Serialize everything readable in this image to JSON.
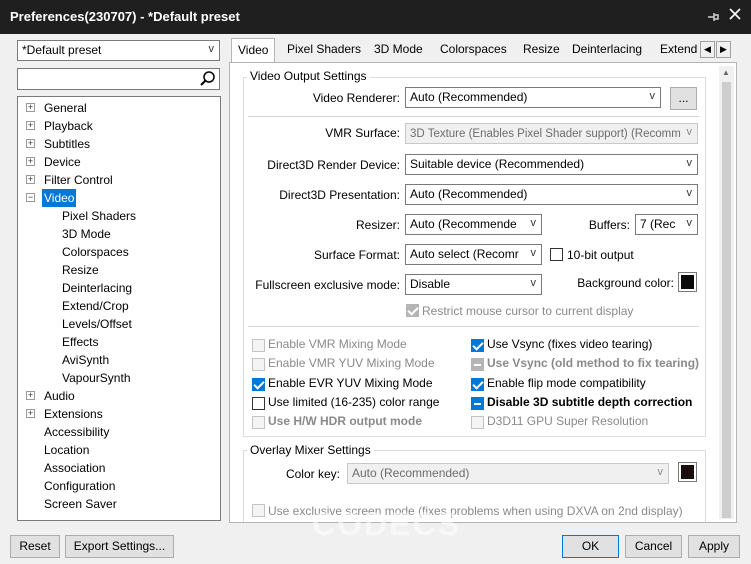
{
  "window": {
    "title": "Preferences(230707) - *Default preset",
    "pin_icon": "pin-icon",
    "close_icon": "close-icon"
  },
  "sidebar": {
    "preset_value": "*Default preset",
    "search_placeholder": "",
    "tree": [
      {
        "label": "General",
        "expandable": true,
        "level": 0
      },
      {
        "label": "Playback",
        "expandable": true,
        "level": 0
      },
      {
        "label": "Subtitles",
        "expandable": true,
        "level": 0
      },
      {
        "label": "Device",
        "expandable": true,
        "level": 0
      },
      {
        "label": "Filter Control",
        "expandable": true,
        "level": 0
      },
      {
        "label": "Video",
        "expandable": true,
        "expanded": true,
        "selected": true,
        "level": 0
      },
      {
        "label": "Pixel Shaders",
        "level": 1
      },
      {
        "label": "3D Mode",
        "level": 1
      },
      {
        "label": "Colorspaces",
        "level": 1
      },
      {
        "label": "Resize",
        "level": 1
      },
      {
        "label": "Deinterlacing",
        "level": 1
      },
      {
        "label": "Extend/Crop",
        "level": 1
      },
      {
        "label": "Levels/Offset",
        "level": 1
      },
      {
        "label": "Effects",
        "level": 1
      },
      {
        "label": "AviSynth",
        "level": 1
      },
      {
        "label": "VapourSynth",
        "level": 1
      },
      {
        "label": "Audio",
        "expandable": true,
        "level": 0
      },
      {
        "label": "Extensions",
        "expandable": true,
        "level": 0
      },
      {
        "label": "Accessibility",
        "level": 0
      },
      {
        "label": "Location",
        "level": 0
      },
      {
        "label": "Association",
        "level": 0
      },
      {
        "label": "Configuration",
        "level": 0
      },
      {
        "label": "Screen Saver",
        "level": 0
      }
    ]
  },
  "tabs": [
    "Video",
    "Pixel Shaders",
    "3D Mode",
    "Colorspaces",
    "Resize",
    "Deinterlacing",
    "Extend"
  ],
  "video_output": {
    "group_title": "Video Output Settings",
    "renderer_label": "Video Renderer:",
    "renderer_value": "Auto (Recommended)",
    "renderer_more": "...",
    "vmr_surface_label": "VMR Surface:",
    "vmr_surface_value": "3D Texture (Enables Pixel Shader support) (Recomm",
    "d3d_device_label": "Direct3D Render Device:",
    "d3d_device_value": "Suitable device (Recommended)",
    "d3d_presentation_label": "Direct3D Presentation:",
    "d3d_presentation_value": "Auto (Recommended)",
    "resizer_label": "Resizer:",
    "resizer_value": "Auto (Recommende",
    "buffers_label": "Buffers:",
    "buffers_value": "7 (Rec",
    "surface_format_label": "Surface Format:",
    "surface_format_value": "Auto select (Recomr",
    "tenbit_label": "10-bit output",
    "fullscreen_label": "Fullscreen exclusive mode:",
    "fullscreen_value": "Disable",
    "bg_color_label": "Background color:",
    "bg_color": "#0a0a0a",
    "restrict_mouse_label": "Restrict mouse cursor to current display"
  },
  "checkboxes_left": [
    {
      "label": "Enable VMR Mixing Mode",
      "checked": false,
      "disabled": true,
      "bold": false
    },
    {
      "label": "Enable VMR YUV Mixing Mode",
      "checked": false,
      "disabled": true,
      "bold": false
    },
    {
      "label": "Enable EVR YUV Mixing Mode",
      "checked": true,
      "disabled": false,
      "bold": false
    },
    {
      "label": "Use limited (16-235) color range",
      "checked": false,
      "disabled": false,
      "bold": false
    },
    {
      "label": "Use H/W HDR output mode",
      "checked": false,
      "disabled": true,
      "bold": true
    }
  ],
  "checkboxes_right": [
    {
      "label": "Use Vsync (fixes video tearing)",
      "state": "checked",
      "disabled": false,
      "bold": false
    },
    {
      "label": "Use Vsync (old method to fix tearing)",
      "state": "indeterminate",
      "disabled": true,
      "bold": true
    },
    {
      "label": "Enable flip mode compatibility",
      "state": "checked",
      "disabled": false,
      "bold": false
    },
    {
      "label": "Disable 3D subtitle depth correction",
      "state": "indeterminate",
      "disabled": false,
      "bold": true
    },
    {
      "label": "D3D11 GPU Super Resolution",
      "state": "unchecked",
      "disabled": true,
      "bold": false
    }
  ],
  "overlay": {
    "group_title": "Overlay Mixer Settings",
    "color_key_label": "Color key:",
    "color_key_value": "Auto (Recommended)",
    "color_key_color": "#1a0d0d",
    "exclusive_label": "Use exclusive screen mode (fixes problems when using DXVA on 2nd display)"
  },
  "footer": {
    "reset": "Reset",
    "export": "Export Settings...",
    "ok": "OK",
    "cancel": "Cancel",
    "apply": "Apply"
  },
  "watermark": "CODECS",
  "colors": {
    "accent": "#0078d7",
    "titlebar": "#1f1f1f"
  }
}
